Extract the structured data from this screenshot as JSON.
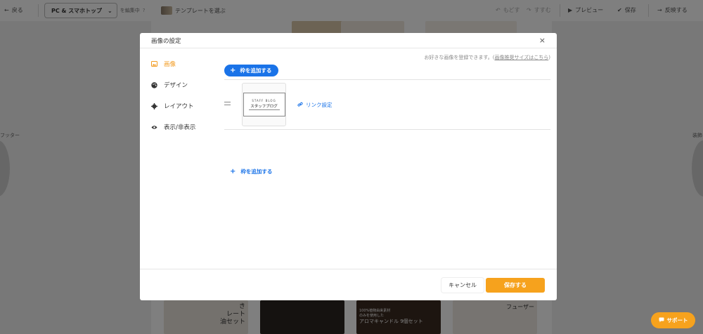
{
  "topbar": {
    "back": "戻る",
    "device_select": "PC & スマホトップ",
    "editing_label": "を編集中",
    "template_label": "テンプレートを選ぶ",
    "undo": "もどす",
    "redo": "すすむ",
    "preview": "プレビュー",
    "save": "保存",
    "publish": "反映する"
  },
  "background": {
    "left_label": "フッター",
    "right_label": "装飾",
    "card_texts": [
      "き",
      "レート",
      "油セット",
      "100%植物由来素材",
      "のみを使用した",
      "アロマキャンドル 9個セット",
      "フューザー"
    ]
  },
  "modal": {
    "title": "画像の設定",
    "close": "×",
    "menu": [
      {
        "label": "画像",
        "active": true,
        "icon": "image-icon"
      },
      {
        "label": "デザイン",
        "active": false,
        "icon": "palette-icon"
      },
      {
        "label": "レイアウト",
        "active": false,
        "icon": "gear-icon"
      },
      {
        "label": "表示/非表示",
        "active": false,
        "icon": "eye-icon"
      }
    ],
    "hint_prefix": "お好きな画像を登録できます。(",
    "hint_link": "画像推奨サイズはこちら",
    "hint_suffix": ")",
    "add_frame_label": "枠を追加する",
    "link_setting": "リンク設定",
    "logo_top": "STAFF BLOG",
    "logo_main": "スタッフブログ",
    "cancel": "キャンセル",
    "save": "保存する"
  },
  "support": "サポート",
  "colors": {
    "accent_orange": "#f6a21d",
    "primary_blue": "#1a73e8"
  }
}
